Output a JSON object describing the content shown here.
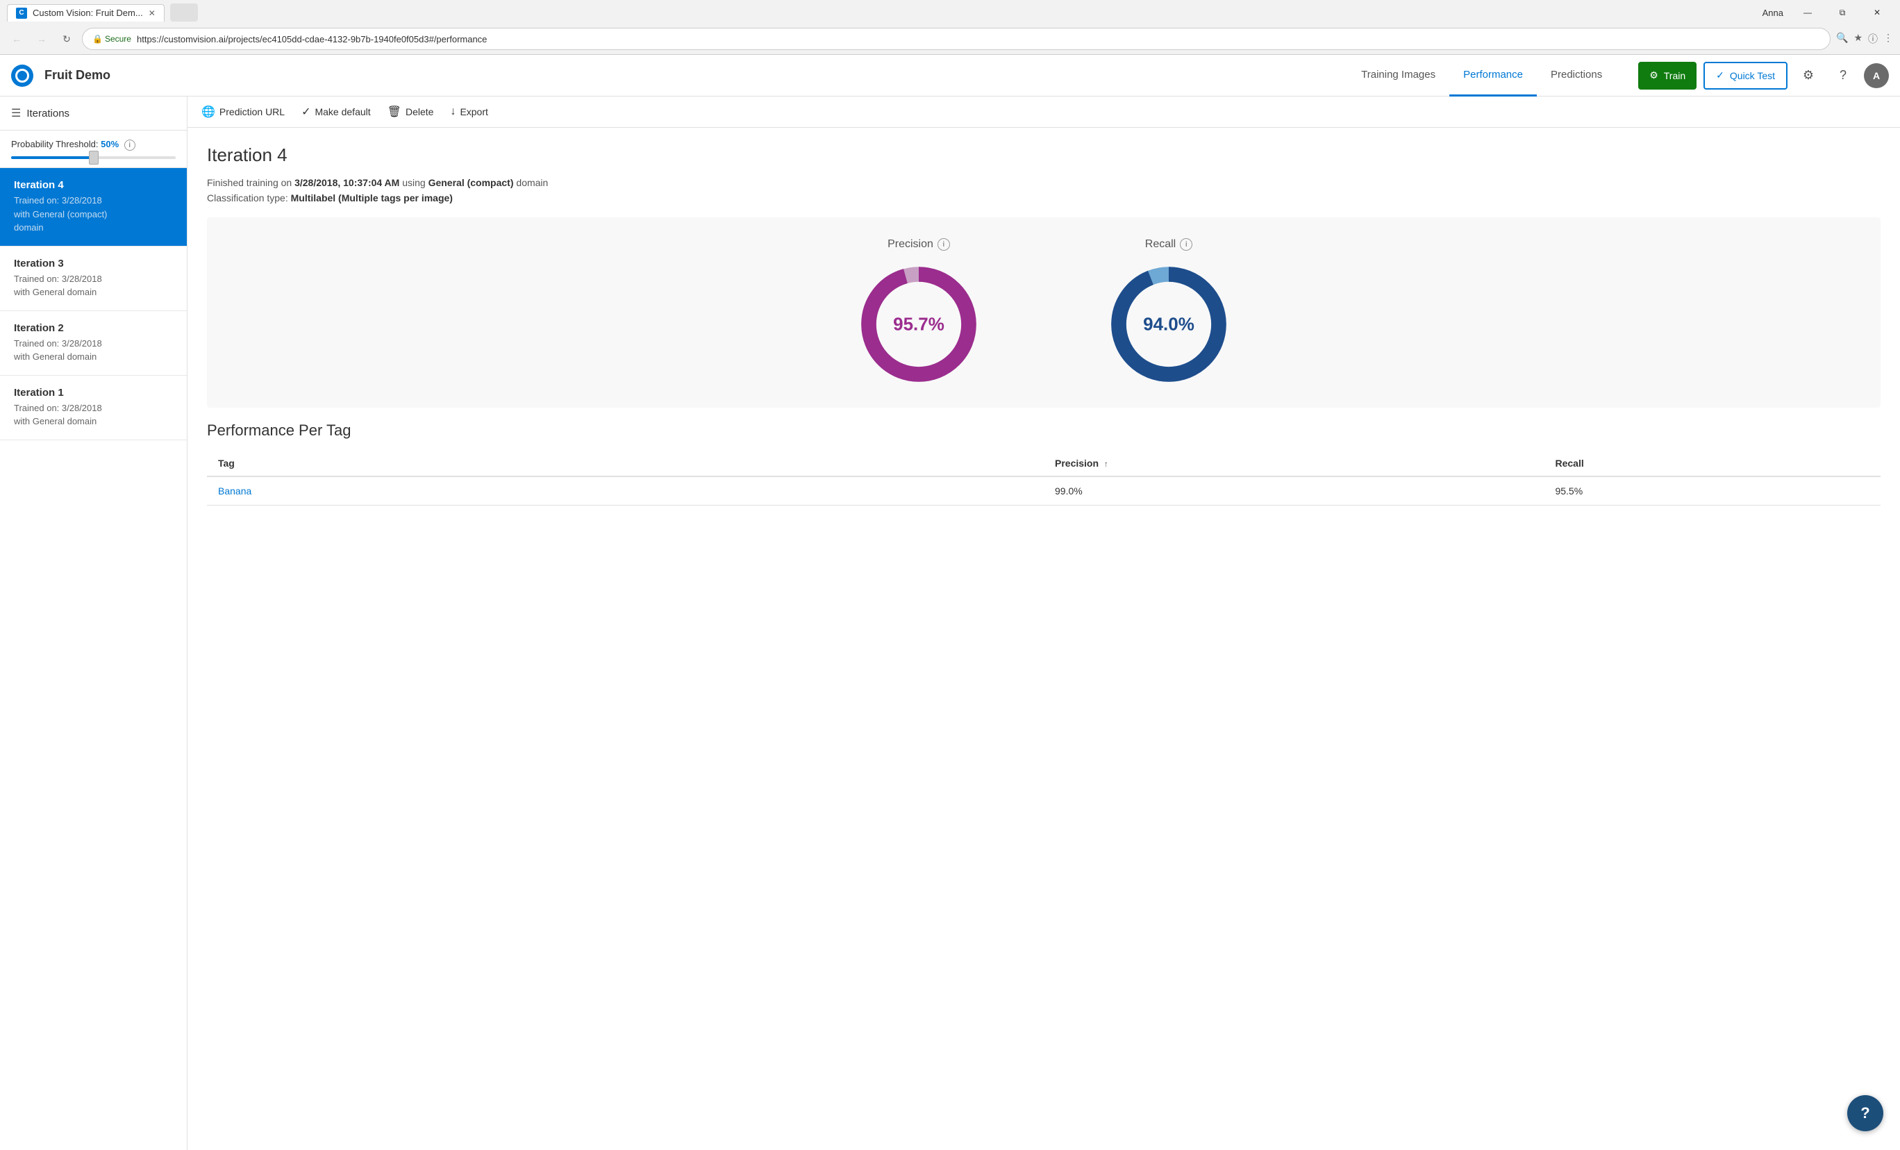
{
  "browser": {
    "tab_title": "Custom Vision: Fruit Dem...",
    "url": "https://customvision.ai/projects/ec4105dd-cdae-4132-9b7b-1940fe0f05d3#/performance",
    "secure_label": "Secure",
    "user_name": "Anna",
    "win_minimize": "—",
    "win_restore": "⧉",
    "win_close": "✕"
  },
  "app": {
    "logo_letter": "C",
    "title": "Fruit Demo",
    "nav": [
      {
        "id": "training-images",
        "label": "Training Images",
        "active": false
      },
      {
        "id": "performance",
        "label": "Performance",
        "active": true
      },
      {
        "id": "predictions",
        "label": "Predictions",
        "active": false
      }
    ],
    "train_btn": "Train",
    "quicktest_btn": "Quick Test"
  },
  "sidebar": {
    "title": "Iterations",
    "probability_label": "Probability Threshold:",
    "probability_value": "50%",
    "iterations": [
      {
        "id": "iteration-4",
        "title": "Iteration 4",
        "subtitle": "Trained on: 3/28/2018\nwith General (compact)\ndomain",
        "active": true
      },
      {
        "id": "iteration-3",
        "title": "Iteration 3",
        "subtitle": "Trained on: 3/28/2018\nwith General domain",
        "active": false
      },
      {
        "id": "iteration-2",
        "title": "Iteration 2",
        "subtitle": "Trained on: 3/28/2018\nwith General domain",
        "active": false
      },
      {
        "id": "iteration-1",
        "title": "Iteration 1",
        "subtitle": "Trained on: 3/28/2018\nwith General domain",
        "active": false
      }
    ]
  },
  "toolbar": {
    "prediction_url": "Prediction URL",
    "make_default": "Make default",
    "delete": "Delete",
    "export": "Export"
  },
  "content": {
    "iteration_title": "Iteration 4",
    "training_info": "Finished training on 3/28/2018, 10:37:04 AM using General (compact) domain",
    "classification_type": "Multilabel (Multiple tags per image)",
    "precision_label": "Precision",
    "recall_label": "Recall",
    "precision_value": "95.7%",
    "recall_value": "94.0%",
    "precision_color": "#9b2d8e",
    "precision_bg_color": "#c8a0c4",
    "recall_color": "#1e4d8c",
    "recall_bg_color": "#6ea8d4",
    "precision_percent": 95.7,
    "recall_percent": 94.0,
    "perf_per_tag_title": "Performance Per Tag",
    "table_headers": {
      "tag": "Tag",
      "precision": "Precision",
      "recall": "Recall"
    },
    "table_rows": [
      {
        "tag": "Banana",
        "precision": "99.0%",
        "recall": "95.5%"
      }
    ]
  },
  "help_btn": "?"
}
